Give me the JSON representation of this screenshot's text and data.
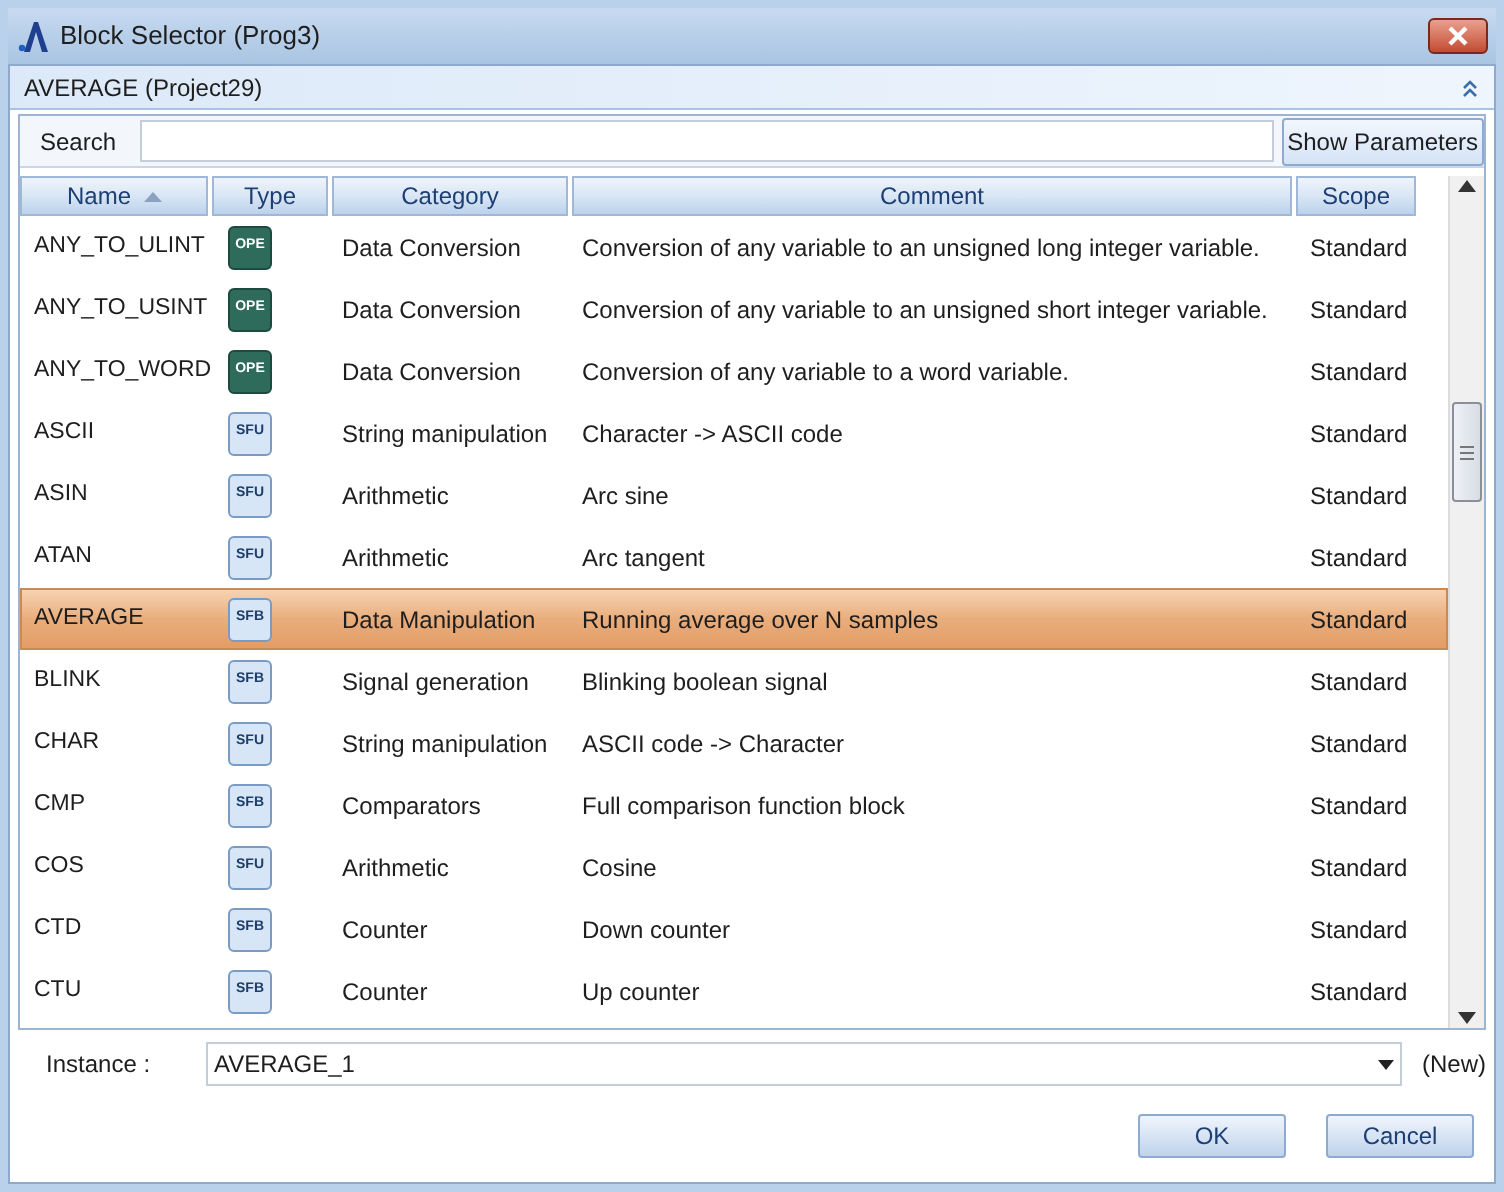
{
  "window": {
    "title": "Block Selector (Prog3)"
  },
  "panel": {
    "title": "AVERAGE (Project29)",
    "collapsed": false
  },
  "search": {
    "label": "Search"
  },
  "show_parameters": "Show Parameters",
  "table": {
    "columns": [
      {
        "label": "Name",
        "sorted_ascending": true
      },
      {
        "label": "Type",
        "sorted_ascending": false
      },
      {
        "label": "Category",
        "sorted_ascending": false
      },
      {
        "label": "Comment",
        "sorted_ascending": false
      },
      {
        "label": "Scope",
        "sorted_ascending": false
      }
    ],
    "rows": [
      {
        "name": "ANY_TO_ULINT",
        "type": "OPE",
        "kind": "operator",
        "category": "Data Conversion",
        "comment": "Conversion of any variable to an unsigned long integer variable.",
        "scope": "Standard",
        "selected": false
      },
      {
        "name": "ANY_TO_USINT",
        "type": "OPE",
        "kind": "operator",
        "category": "Data Conversion",
        "comment": "Conversion of any variable to an unsigned short integer variable.",
        "scope": "Standard",
        "selected": false
      },
      {
        "name": "ANY_TO_WORD",
        "type": "OPE",
        "kind": "operator",
        "category": "Data Conversion",
        "comment": "Conversion of any variable to a word variable.",
        "scope": "Standard",
        "selected": false
      },
      {
        "name": "ASCII",
        "type": "SFU",
        "kind": "function",
        "category": "String manipulation",
        "comment": "Character -> ASCII code",
        "scope": "Standard",
        "selected": false
      },
      {
        "name": "ASIN",
        "type": "SFU",
        "kind": "function",
        "category": "Arithmetic",
        "comment": "Arc sine",
        "scope": "Standard",
        "selected": false
      },
      {
        "name": "ATAN",
        "type": "SFU",
        "kind": "function",
        "category": "Arithmetic",
        "comment": "Arc tangent",
        "scope": "Standard",
        "selected": false
      },
      {
        "name": "AVERAGE",
        "type": "SFB",
        "kind": "function",
        "category": "Data Manipulation",
        "comment": "Running average over N samples",
        "scope": "Standard",
        "selected": true
      },
      {
        "name": "BLINK",
        "type": "SFB",
        "kind": "function",
        "category": "Signal generation",
        "comment": "Blinking boolean signal",
        "scope": "Standard",
        "selected": false
      },
      {
        "name": "CHAR",
        "type": "SFU",
        "kind": "function",
        "category": "String manipulation",
        "comment": "ASCII code -> Character",
        "scope": "Standard",
        "selected": false
      },
      {
        "name": "CMP",
        "type": "SFB",
        "kind": "function",
        "category": "Comparators",
        "comment": "Full comparison function block",
        "scope": "Standard",
        "selected": false
      },
      {
        "name": "COS",
        "type": "SFU",
        "kind": "function",
        "category": "Arithmetic",
        "comment": "Cosine",
        "scope": "Standard",
        "selected": false
      },
      {
        "name": "CTD",
        "type": "SFB",
        "kind": "function",
        "category": "Counter",
        "comment": "Down counter",
        "scope": "Standard",
        "selected": false
      },
      {
        "name": "CTU",
        "type": "SFB",
        "kind": "function",
        "category": "Counter",
        "comment": "Up counter",
        "scope": "Standard",
        "selected": false
      }
    ]
  },
  "instance": {
    "label": "Instance :",
    "value": "AVERAGE_1",
    "note": "(New)"
  },
  "buttons": [
    "OK",
    "Cancel"
  ]
}
